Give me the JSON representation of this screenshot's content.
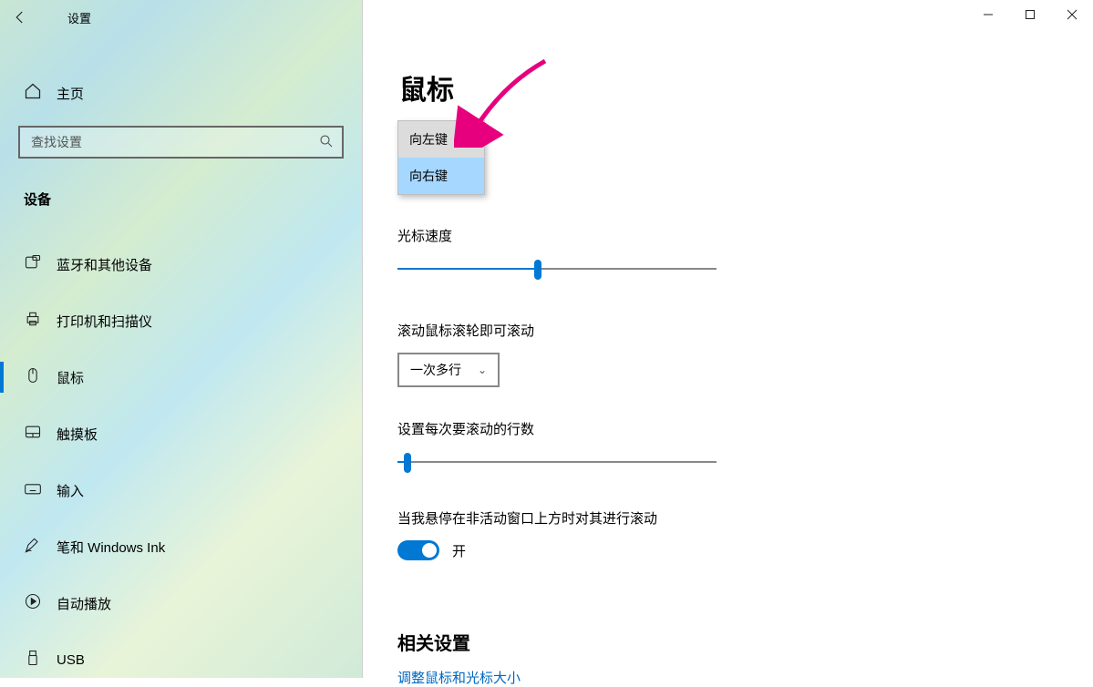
{
  "window": {
    "title": "设置"
  },
  "sidebar": {
    "home": "主页",
    "search_placeholder": "查找设置",
    "section": "设备",
    "items": [
      {
        "icon": "bluetooth",
        "label": "蓝牙和其他设备"
      },
      {
        "icon": "printer",
        "label": "打印机和扫描仪"
      },
      {
        "icon": "mouse",
        "label": "鼠标",
        "active": true
      },
      {
        "icon": "touchpad",
        "label": "触摸板"
      },
      {
        "icon": "keyboard",
        "label": "输入"
      },
      {
        "icon": "pen",
        "label": "笔和 Windows Ink"
      },
      {
        "icon": "autoplay",
        "label": "自动播放"
      },
      {
        "icon": "usb",
        "label": "USB"
      }
    ]
  },
  "main": {
    "title": "鼠标",
    "primary_button_options": {
      "left": "向左键",
      "right": "向右键",
      "selected": "right"
    },
    "cursor_speed": {
      "label": "光标速度",
      "value": 44,
      "max": 100
    },
    "scroll_mode": {
      "label": "滚动鼠标滚轮即可滚动",
      "value": "一次多行"
    },
    "lines_per_scroll": {
      "label": "设置每次要滚动的行数",
      "value": 3,
      "max": 100
    },
    "hover_scroll": {
      "label": "当我悬停在非活动窗口上方时对其进行滚动",
      "state_label": "开",
      "on": true
    },
    "related": {
      "title": "相关设置",
      "link": "调整鼠标和光标大小"
    }
  }
}
